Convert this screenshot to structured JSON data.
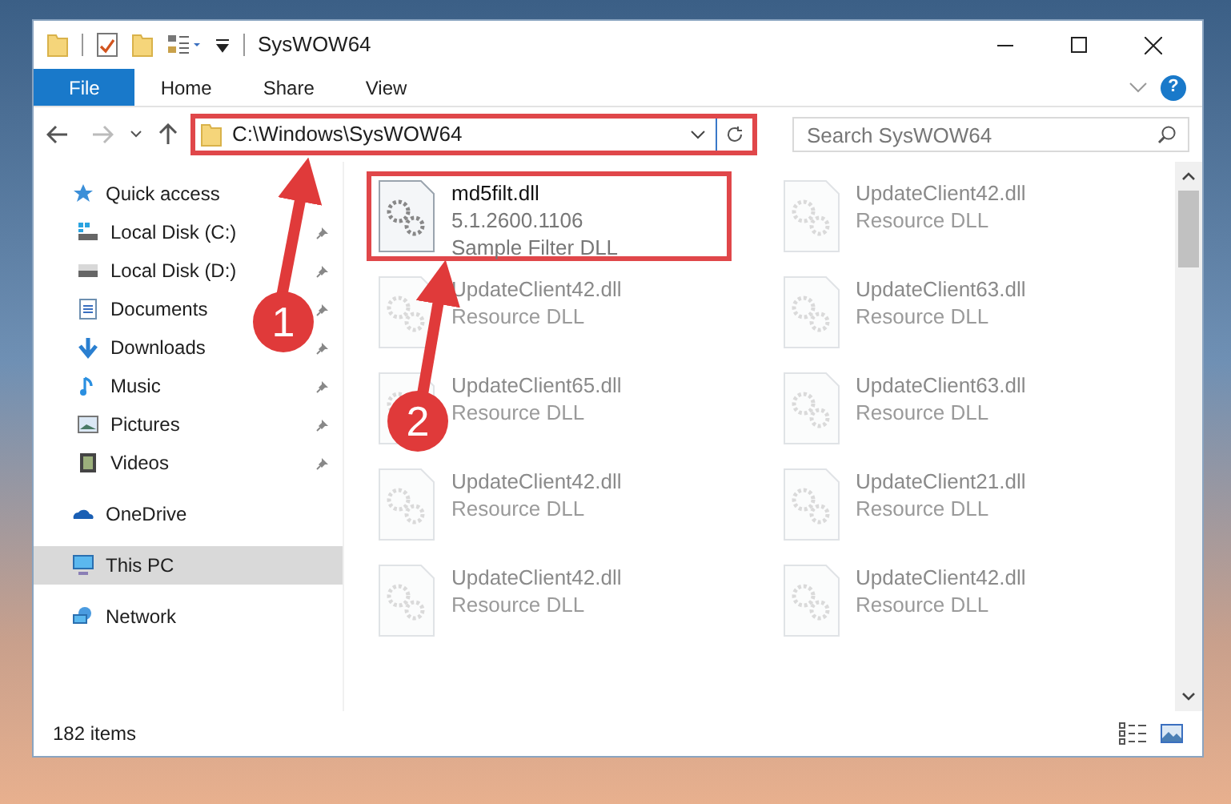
{
  "window": {
    "title": "SysWOW64"
  },
  "ribbon": {
    "tabs": [
      {
        "label": "File",
        "selected": true
      },
      {
        "label": "Home",
        "selected": false
      },
      {
        "label": "Share",
        "selected": false
      },
      {
        "label": "View",
        "selected": false
      }
    ],
    "help": "?"
  },
  "address_bar": {
    "path": "C:\\Windows\\SysWOW64",
    "highlighted": true
  },
  "search": {
    "placeholder": "Search SysWOW64"
  },
  "sidebar": {
    "items": [
      {
        "label": "Quick access",
        "kind": "star",
        "selected": false,
        "children": [
          {
            "label": "Local Disk (C:)",
            "kind": "system-drive",
            "pinned": true,
            "selected": false
          },
          {
            "label": "Local Disk (D:)",
            "kind": "drive",
            "pinned": true,
            "selected": false
          },
          {
            "label": "Documents",
            "kind": "documents",
            "pinned": true,
            "selected": false
          },
          {
            "label": "Downloads",
            "kind": "downloads",
            "pinned": true,
            "selected": false
          },
          {
            "label": "Music",
            "kind": "music",
            "pinned": true,
            "selected": false
          },
          {
            "label": "Pictures",
            "kind": "pictures",
            "pinned": true,
            "selected": false
          },
          {
            "label": "Videos",
            "kind": "videos",
            "pinned": true,
            "selected": false
          }
        ]
      },
      {
        "label": "OneDrive",
        "kind": "cloud",
        "selected": false
      },
      {
        "label": "This PC",
        "kind": "computer",
        "selected": true
      },
      {
        "label": "Network",
        "kind": "network",
        "selected": false
      }
    ]
  },
  "files": [
    {
      "name": "md5filt.dll",
      "details": [
        "5.1.2600.1106",
        "Sample Filter DLL"
      ],
      "highlighted": true,
      "blurred": false
    },
    {
      "name": "UpdateClient42.dll",
      "details": [
        "Resource DLL"
      ],
      "highlighted": false,
      "blurred": true
    },
    {
      "name": "UpdateClient42.dll",
      "details": [
        "Resource DLL"
      ],
      "highlighted": false,
      "blurred": true
    },
    {
      "name": "UpdateClient63.dll",
      "details": [
        "Resource DLL"
      ],
      "highlighted": false,
      "blurred": true
    },
    {
      "name": "UpdateClient65.dll",
      "details": [
        "Resource DLL"
      ],
      "highlighted": false,
      "blurred": true
    },
    {
      "name": "UpdateClient63.dll",
      "details": [
        "Resource DLL"
      ],
      "highlighted": false,
      "blurred": true
    },
    {
      "name": "UpdateClient42.dll",
      "details": [
        "Resource DLL"
      ],
      "highlighted": false,
      "blurred": true
    },
    {
      "name": "UpdateClient21.dll",
      "details": [
        "Resource DLL"
      ],
      "highlighted": false,
      "blurred": true
    },
    {
      "name": "UpdateClient42.dll",
      "details": [
        "Resource DLL"
      ],
      "highlighted": false,
      "blurred": true
    },
    {
      "name": "UpdateClient42.dll",
      "details": [
        "Resource DLL"
      ],
      "highlighted": false,
      "blurred": true
    }
  ],
  "status_bar": {
    "item_count": "182 items"
  },
  "annotations": [
    {
      "number": "1"
    },
    {
      "number": "2"
    }
  ]
}
